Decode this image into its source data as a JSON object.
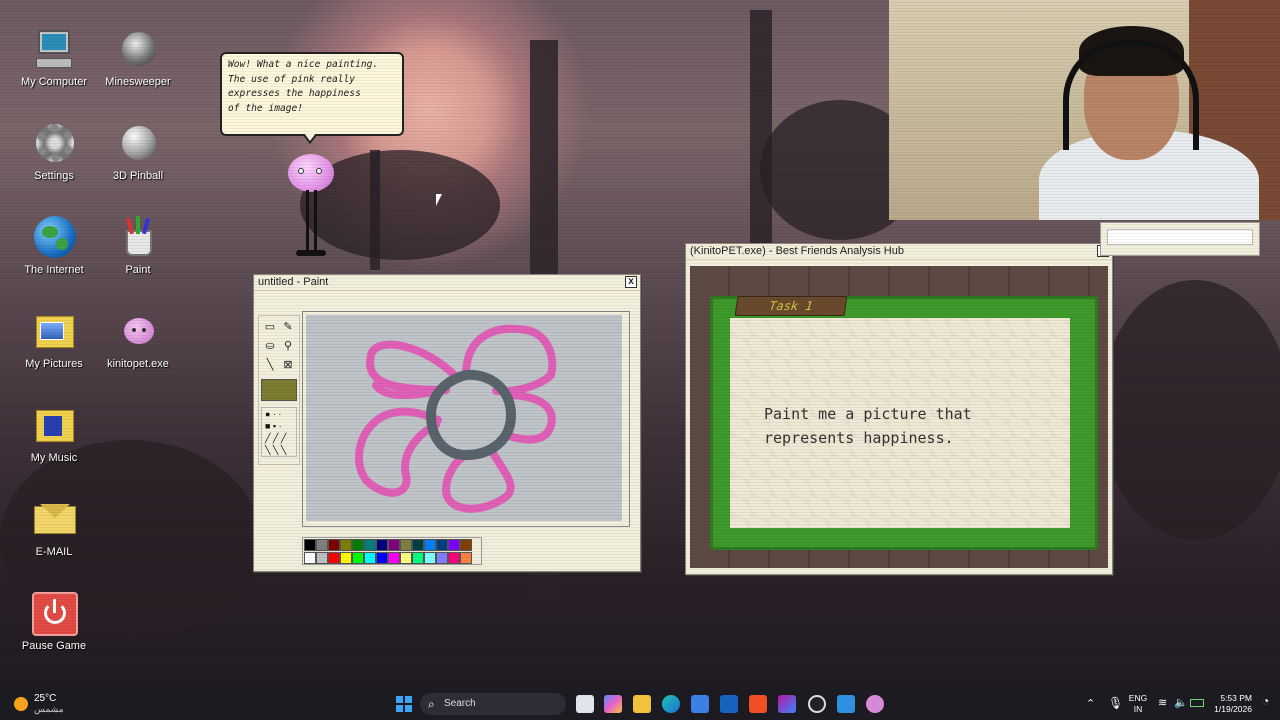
{
  "desktop": {
    "icons": [
      {
        "label": "My Computer"
      },
      {
        "label": "Minesweeper"
      },
      {
        "label": "Settings"
      },
      {
        "label": "3D Pinball"
      },
      {
        "label": "The Internet"
      },
      {
        "label": "Paint"
      },
      {
        "label": "My Pictures"
      },
      {
        "label": "kinitopet.exe"
      },
      {
        "label": "My Music"
      },
      {
        "label": "E-MAIL"
      },
      {
        "label": "Pause Game"
      }
    ]
  },
  "pet": {
    "speech_lines": [
      "Wow! What a nice painting.",
      "The use of pink really",
      "expresses the happiness",
      "of the image!"
    ]
  },
  "paint_window": {
    "title": "untitled - Paint",
    "close_label": "x",
    "active_color": "#7d7d32",
    "palette_top": [
      "#000000",
      "#808080",
      "#800000",
      "#808000",
      "#008000",
      "#008080",
      "#000080",
      "#800080",
      "#808040",
      "#004040",
      "#0080ff",
      "#004080",
      "#8000ff",
      "#804000"
    ],
    "palette_bottom": [
      "#ffffff",
      "#c0c0c0",
      "#ff0000",
      "#ffff00",
      "#00ff00",
      "#00ffff",
      "#0000ff",
      "#ff00ff",
      "#ffff80",
      "#00ff80",
      "#80ffff",
      "#8080ff",
      "#ff0080",
      "#ff8040"
    ]
  },
  "analysis_window": {
    "title": "(KinitoPET.exe) - Best Friends Analysis Hub",
    "close_label": "x",
    "task_tag": "Task 1",
    "message_line1": "Paint me a picture that",
    "message_line2": "represents happiness."
  },
  "taskbar": {
    "weather_temp": "25°C",
    "weather_desc": "مشمس",
    "search_label": "Search",
    "lang_top": "ENG",
    "lang_bottom": "IN",
    "time": "5:53 PM",
    "date": "1/19/2026"
  },
  "colors": {
    "flower_pink": "#e060b8",
    "flower_center": "#5a646c",
    "canvas_bg": "#bfc4c8",
    "grass_green": "#3e9a2a",
    "note_bg": "#efe9d6"
  }
}
